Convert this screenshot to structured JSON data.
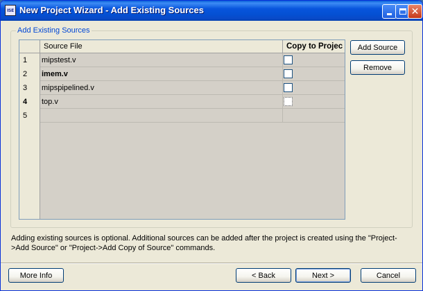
{
  "window": {
    "title": "New Project Wizard - Add Existing Sources",
    "app_icon_text": "ISE"
  },
  "group": {
    "label": "Add Existing Sources"
  },
  "table": {
    "headers": {
      "source": "Source File",
      "copy": "Copy to Projec"
    },
    "rows": [
      {
        "num": "1",
        "source": "mipstest.v",
        "copy_checked": false
      },
      {
        "num": "2",
        "source": "imem.v",
        "copy_checked": false
      },
      {
        "num": "3",
        "source": "mipspipelined.v",
        "copy_checked": false
      },
      {
        "num": "4",
        "source": "top.v",
        "copy_checked": false
      },
      {
        "num": "5",
        "source": "",
        "copy_checked": null
      }
    ]
  },
  "buttons": {
    "add_source": "Add Source",
    "remove": "Remove",
    "more_info": "More Info",
    "back": "< Back",
    "next": "Next >",
    "cancel": "Cancel"
  },
  "info_text": "Adding existing sources is optional. Additional sources can be added after the project is created using the \"Project->Add Source\" or \"Project->Add Copy of Source\" commands."
}
